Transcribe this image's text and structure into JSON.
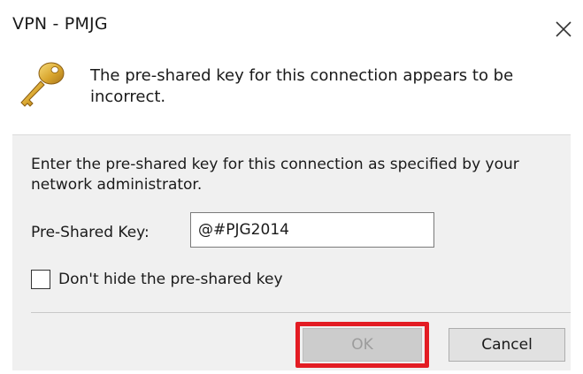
{
  "window": {
    "title": "VPN - PMJG",
    "close_icon": "close-icon"
  },
  "message": {
    "icon": "key-icon",
    "text": "The pre-shared key for this connection appears to be incorrect."
  },
  "form": {
    "instructions": "Enter the pre-shared key for this connection as specified by your network administrator.",
    "psk_label": "Pre-Shared Key:",
    "psk_value": "@#PJG2014",
    "checkbox_label": "Don't hide the pre-shared key",
    "checkbox_checked": false
  },
  "buttons": {
    "ok_label": "OK",
    "ok_disabled": true,
    "cancel_label": "Cancel"
  },
  "colors": {
    "highlight": "#e31c23",
    "panel_bg": "#f0f0f0"
  }
}
